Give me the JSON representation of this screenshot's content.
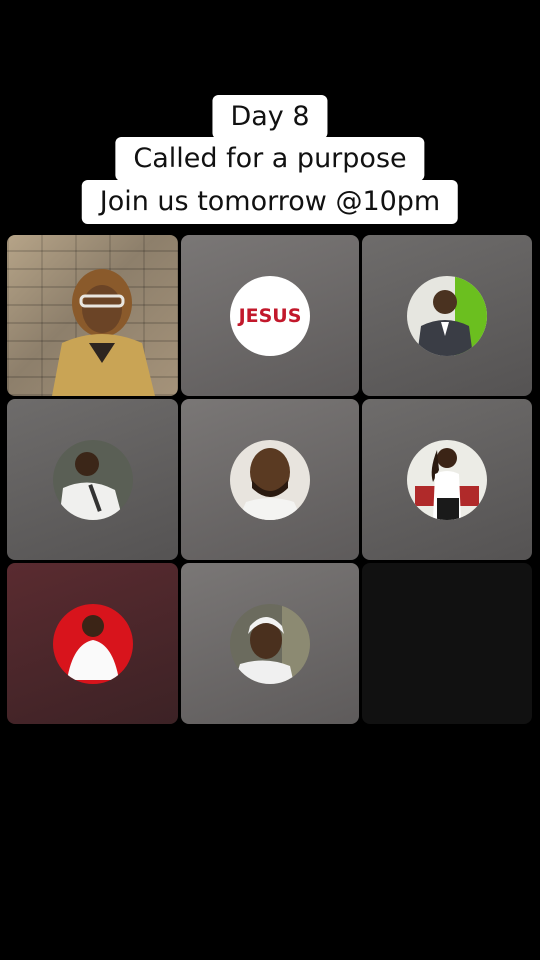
{
  "caption": {
    "line1": "Day 8",
    "line2": "Called for a purpose",
    "line3": "Join us tomorrow @10pm"
  },
  "participants": [
    {
      "kind": "video",
      "name": "presenter-video"
    },
    {
      "kind": "avatar",
      "badge": "JESUS"
    },
    {
      "kind": "avatar"
    },
    {
      "kind": "avatar"
    },
    {
      "kind": "avatar"
    },
    {
      "kind": "avatar"
    },
    {
      "kind": "avatar"
    },
    {
      "kind": "avatar"
    },
    {
      "kind": "empty"
    }
  ],
  "colors": {
    "background": "#000000",
    "caption_bg": "#ffffff",
    "badge_text": "#c2182b"
  }
}
